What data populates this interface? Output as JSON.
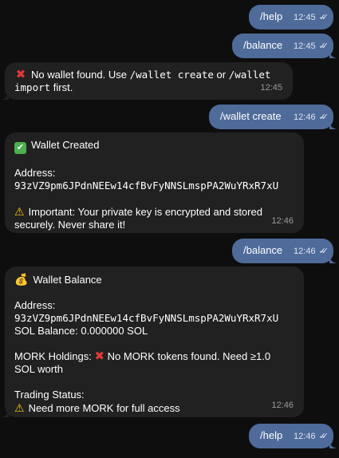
{
  "messages": [
    {
      "type": "outgoing",
      "text": "/help",
      "time": "12:45"
    },
    {
      "type": "outgoing",
      "text": "/balance",
      "time": "12:45"
    },
    {
      "type": "incoming",
      "icon": "cross-mark-icon",
      "line1_a": "No wallet found. Use ",
      "line1_cmd1": "/wallet create",
      "line1_b": " or ",
      "line1_cmd2": "/wallet",
      "line2_cmd": "import",
      "line2_b": " first.",
      "time": "12:45"
    },
    {
      "type": "outgoing",
      "text": "/wallet create",
      "time": "12:46"
    },
    {
      "type": "incoming",
      "title": "Wallet Created",
      "address_label": "Address:",
      "address": "93zVZ9pm6JPdnNEEw14cfBvFyNNSLmspPA2WuYRxR7xU",
      "warn1": "Important: Your private key is encrypted and stored",
      "warn2": "securely. Never share it!",
      "time": "12:46"
    },
    {
      "type": "outgoing",
      "text": "/balance",
      "time": "12:46"
    },
    {
      "type": "incoming",
      "title": "Wallet Balance",
      "address_label": "Address:",
      "address": "93zVZ9pm6JPdnNEEw14cfBvFyNNSLmspPA2WuYRxR7xU",
      "sol_balance": "SOL Balance: 0.000000 SOL",
      "mork_label": "MORK Holdings:",
      "mork_text": "No MORK tokens found. Need ≥1.0",
      "mork_text2": "SOL worth",
      "trading_label": "Trading Status:",
      "trading_text": "Need more MORK for full access",
      "time": "12:46"
    },
    {
      "type": "outgoing",
      "text": "/help",
      "time": "12:46"
    }
  ]
}
